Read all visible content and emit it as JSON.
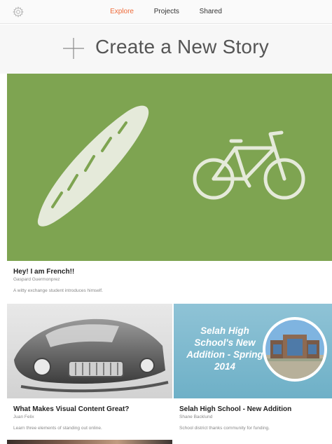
{
  "nav": {
    "settings_icon": "gear-icon",
    "tabs": [
      {
        "label": "Explore",
        "active": true
      },
      {
        "label": "Projects",
        "active": false
      },
      {
        "label": "Shared",
        "active": false
      }
    ],
    "accent_color": "#ef6b3a"
  },
  "create": {
    "icon": "plus-icon",
    "label": "Create a New Story"
  },
  "featured": {
    "title": "Hey! I am French!!",
    "author": "Gaspard Guermonprez",
    "description": "A witty exchange student introduces himself.",
    "background_color": "#7ea451"
  },
  "stories": [
    {
      "title": "What Makes Visual Content Great?",
      "author": "Juan Felix",
      "description": "Learn three elements of standing out online."
    },
    {
      "title": "Selah High School - New Addition",
      "author": "Shane Backlund",
      "description": "School district thanks community for funding.",
      "cover_text": "Selah High School's New Addition - Spring 2014"
    }
  ]
}
